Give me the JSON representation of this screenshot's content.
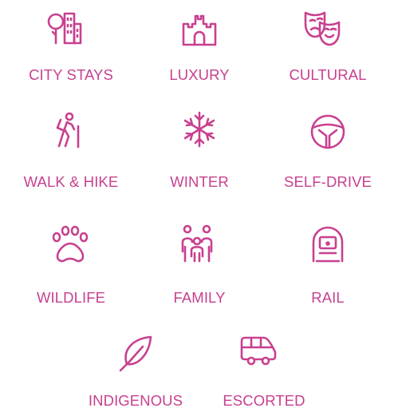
{
  "accent_color": "#c8408f",
  "categories": [
    {
      "label": "CITY STAYS",
      "icon": "city-buildings-icon"
    },
    {
      "label": "LUXURY",
      "icon": "castle-icon"
    },
    {
      "label": "CULTURAL",
      "icon": "theatre-masks-icon"
    },
    {
      "label": "WALK & HIKE",
      "icon": "hiker-icon"
    },
    {
      "label": "WINTER",
      "icon": "snowflake-icon"
    },
    {
      "label": "SELF-DRIVE",
      "icon": "steering-wheel-icon"
    },
    {
      "label": "WILDLIFE",
      "icon": "paw-print-icon"
    },
    {
      "label": "FAMILY",
      "icon": "family-icon"
    },
    {
      "label": "RAIL",
      "icon": "train-icon"
    },
    {
      "label": "INDIGENOUS",
      "icon": "feather-icon"
    },
    {
      "label": "ESCORTED",
      "icon": "van-icon"
    }
  ]
}
